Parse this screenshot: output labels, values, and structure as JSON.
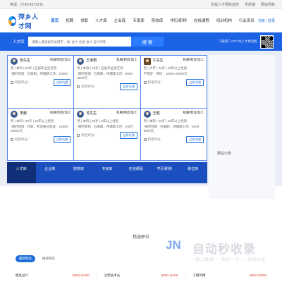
{
  "topbar": {
    "phone": "电话：0799-8372215",
    "links": [
      "您是人才网欢迎您",
      "手机端",
      "网站导航"
    ]
  },
  "header": {
    "logo_text": "萍乡人才网",
    "nav": [
      {
        "label": "首页",
        "active": true
      },
      {
        "label": "招聘",
        "active": false
      },
      {
        "label": "求职",
        "active": false
      },
      {
        "label": "人才库",
        "active": false
      },
      {
        "label": "企业库",
        "active": false
      },
      {
        "label": "专家库",
        "active": false
      },
      {
        "label": "院校库",
        "active": false
      },
      {
        "label": "学历/职称",
        "active": false
      },
      {
        "label": "在线课程",
        "active": false
      },
      {
        "label": "培训机构",
        "active": false
      },
      {
        "label": "行业资讯",
        "active": false
      }
    ],
    "auth": "注册 | 登录"
  },
  "search": {
    "label": "人才库",
    "placeholder": "请输入要搜索的关键字，如: 会计 合规 会计 设计师等",
    "button": "搜 索",
    "app_text": "下载客户APP 找人才更轻松"
  },
  "talents": [
    {
      "name": "张先生",
      "position": "机械/制造/加工",
      "info1": "男 | 本科 | 25岁 | 应届毕业生在校",
      "info2": "·随时到岗 · 已离职，待遇薪工作：10000",
      "eval": "综合评分：",
      "button": "立即沟通",
      "avatar": "round"
    },
    {
      "name": "王家鹏",
      "position": "机械/制造/加工",
      "info1": "男 | 本科 | 23岁 | 应届毕业生在校",
      "info2": "·随时到岗 · 已离职，待遇薪工作：6000-8000元",
      "eval": "综合评分：",
      "button": "立即沟通",
      "avatar": "round"
    },
    {
      "name": "江先生",
      "position": "机械/制造/加工",
      "info1": "男 | 大专 | 33岁 | 10年以上经验",
      "info2": "不限定 · 另找：10000-20000元",
      "eval": "综合评分：",
      "button": "立即沟通",
      "avatar": "square"
    },
    {
      "name": "李鹏",
      "position": "机械/制造/加工",
      "info1": "男 | 本科 | 42岁 | 10年以上经验",
      "info2": "·随时到岗 · 在职，考虑换过机会：15000-20000元",
      "eval": "综合评分：",
      "button": "立即沟通",
      "avatar": "round"
    },
    {
      "name": "苏先生",
      "position": "机械/制造/加工",
      "info1": "男 | 本科 | 39岁 | 8年以上经验",
      "info2": "·随时到岗 · 已离职，待遇薪工作：6-8元",
      "eval": "综合评分：",
      "button": "立即沟通",
      "avatar": "round"
    },
    {
      "name": "王健",
      "position": "机械/制造/加工",
      "info1": "男 | 本科 | 42岁 | 10年以上经验",
      "info2": "·随时到岗 · 已离职，待遇薪工作：6000-8000元",
      "eval": "综合评分：",
      "button": "立即沟通",
      "avatar": "round"
    }
  ],
  "tabs": [
    {
      "label": "人才库",
      "active": true
    },
    {
      "label": "企业库",
      "active": false
    },
    {
      "label": "院校库",
      "active": false
    },
    {
      "label": "专家库",
      "active": false
    },
    {
      "label": "在线课程",
      "active": false
    },
    {
      "label": "学历/职称",
      "active": false
    },
    {
      "label": "职位库",
      "active": false
    }
  ],
  "side_link": "网站公告",
  "section_title": "精选职位",
  "job_tabs": [
    {
      "label": "最新职位",
      "active": true
    },
    {
      "label": "推荐职位",
      "active": false
    }
  ],
  "jobs": [
    {
      "title": "模具设计",
      "salary": "9000-11000"
    },
    {
      "title": "注塑技术员",
      "salary": "9000-11000"
    },
    {
      "title": "工模师傅",
      "salary": "9000-10000"
    }
  ],
  "watermark": {
    "logo": "JN",
    "text": "自动秒收录",
    "sub": "做上链接 一 来访一次 一 自动收录"
  }
}
